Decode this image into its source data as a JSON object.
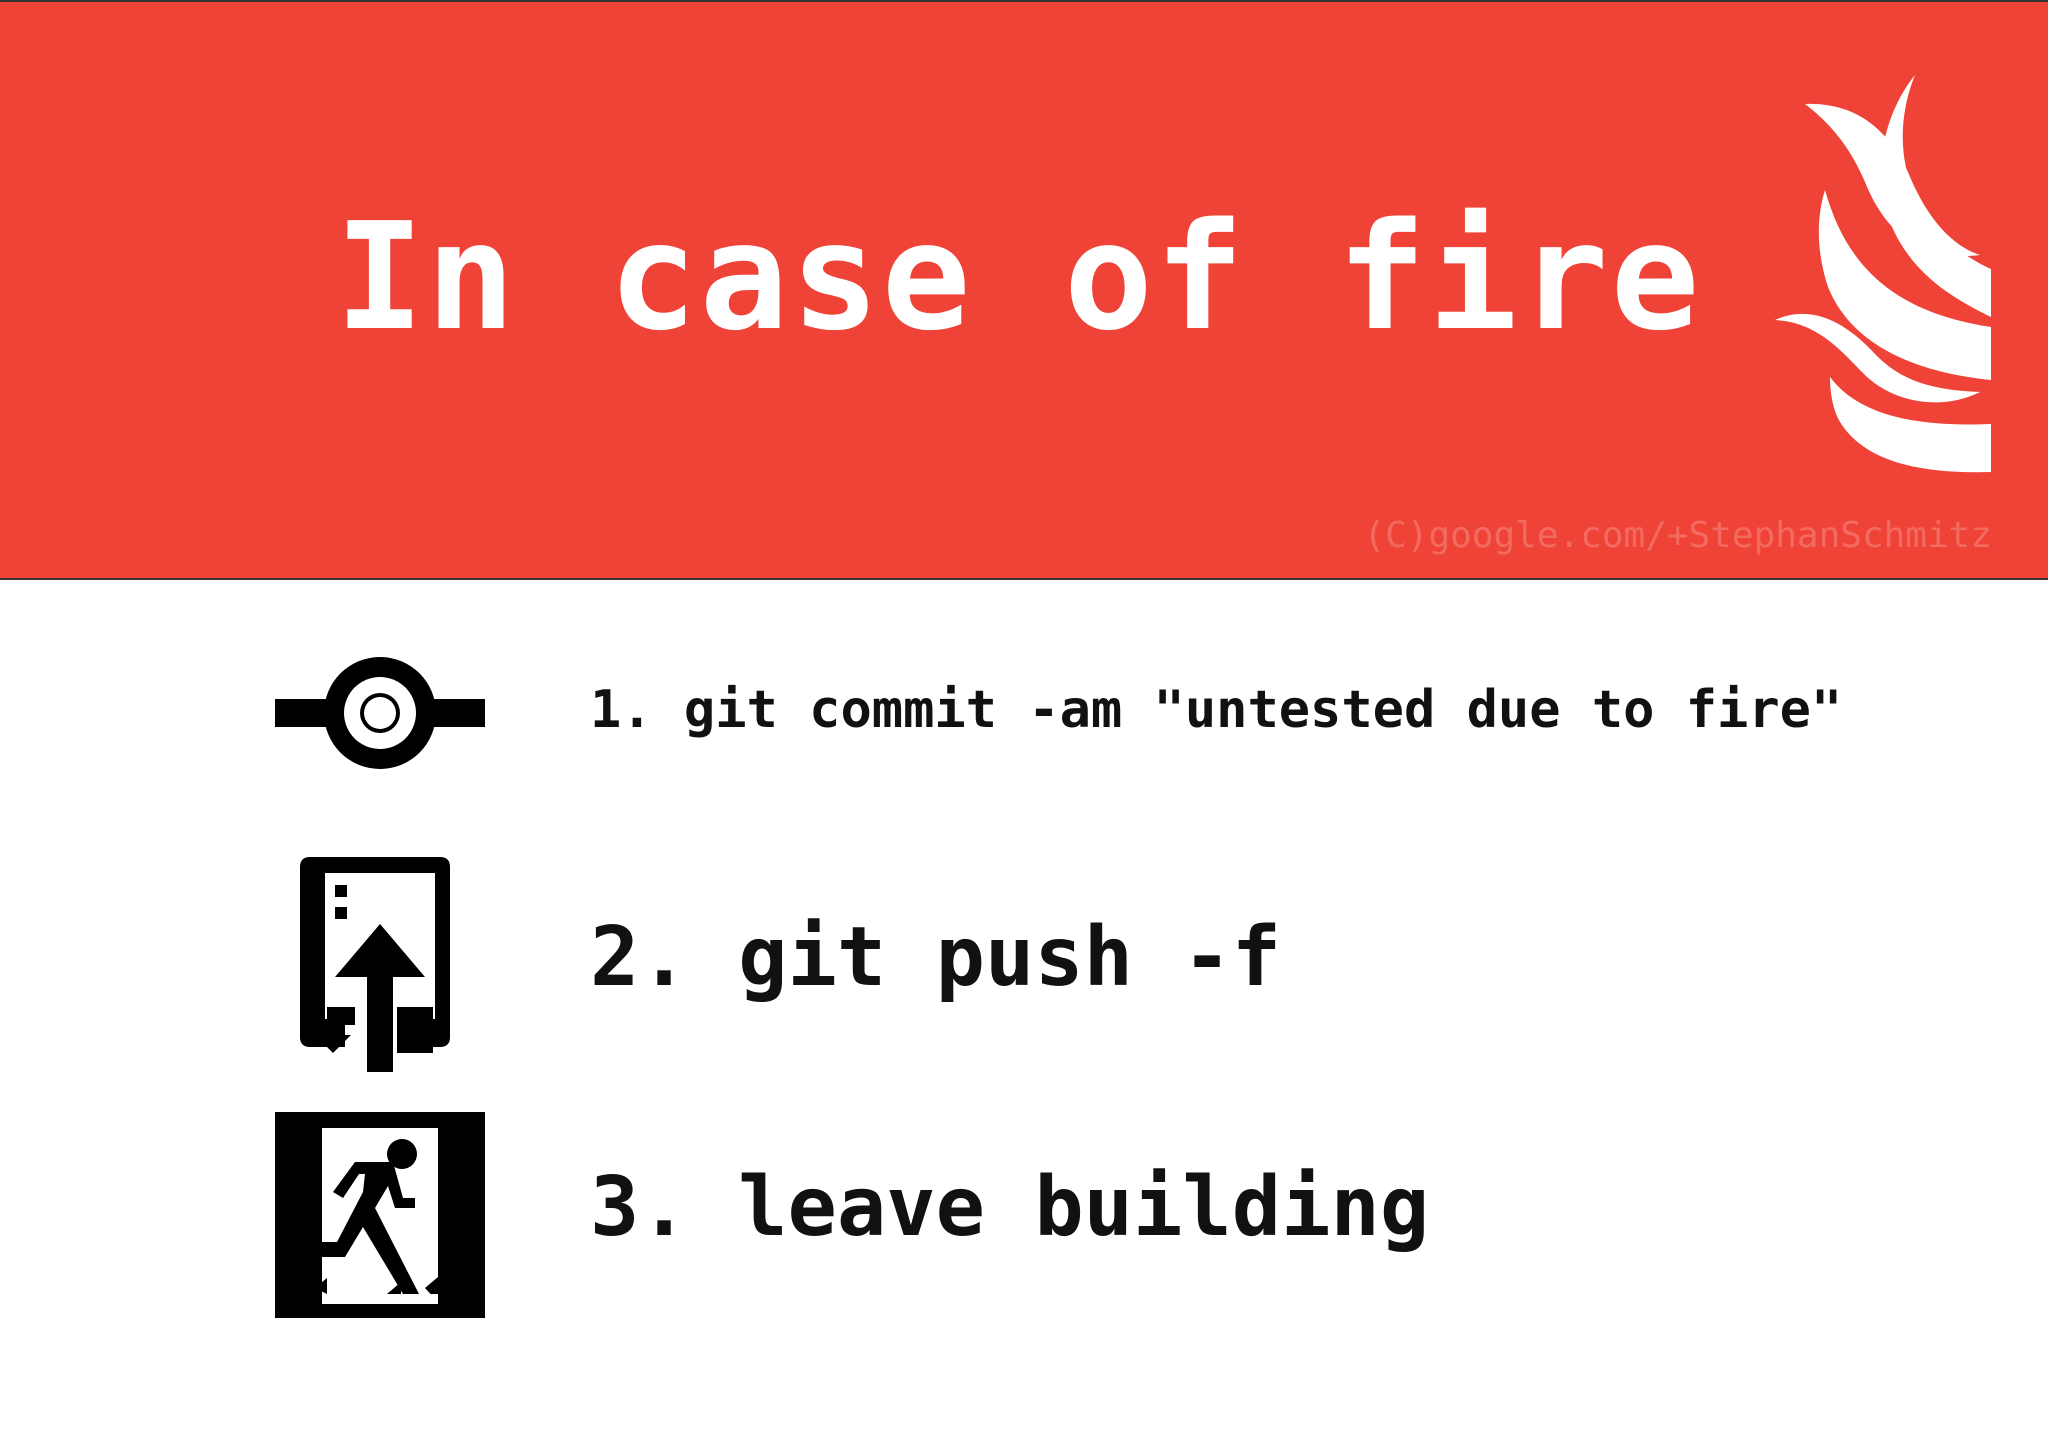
{
  "header": {
    "title": "In case of fire",
    "credit": "(C)google.com/+StephanSchmitz",
    "background_color": "#ef4338",
    "icon": "flame-icon"
  },
  "steps": [
    {
      "icon": "git-commit-icon",
      "text": "1. git commit -am \"untested due to fire\""
    },
    {
      "icon": "elevator-up-icon",
      "text": "2. git push -f"
    },
    {
      "icon": "emergency-exit-icon",
      "text": "3. leave building"
    }
  ]
}
